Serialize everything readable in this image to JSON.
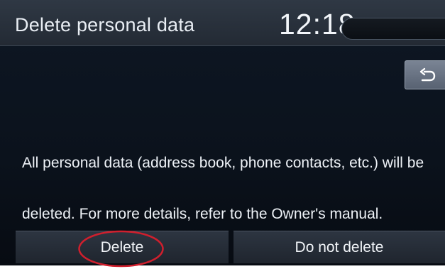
{
  "header": {
    "title": "Delete personal data",
    "clock": "12:18"
  },
  "toolbar": {
    "back_icon": "return-arrow-icon"
  },
  "message": {
    "line1": "All personal data (address book, phone contacts, etc.) will be",
    "line2": "deleted. For more details, refer to the Owner's manual."
  },
  "actions": {
    "delete_label": "Delete",
    "keep_label": "Do not delete"
  },
  "colors": {
    "background": "#0b121c",
    "header": "#2f3844",
    "button": "#2d3541",
    "annotation": "#d01f2d",
    "text": "#eef2f7"
  }
}
